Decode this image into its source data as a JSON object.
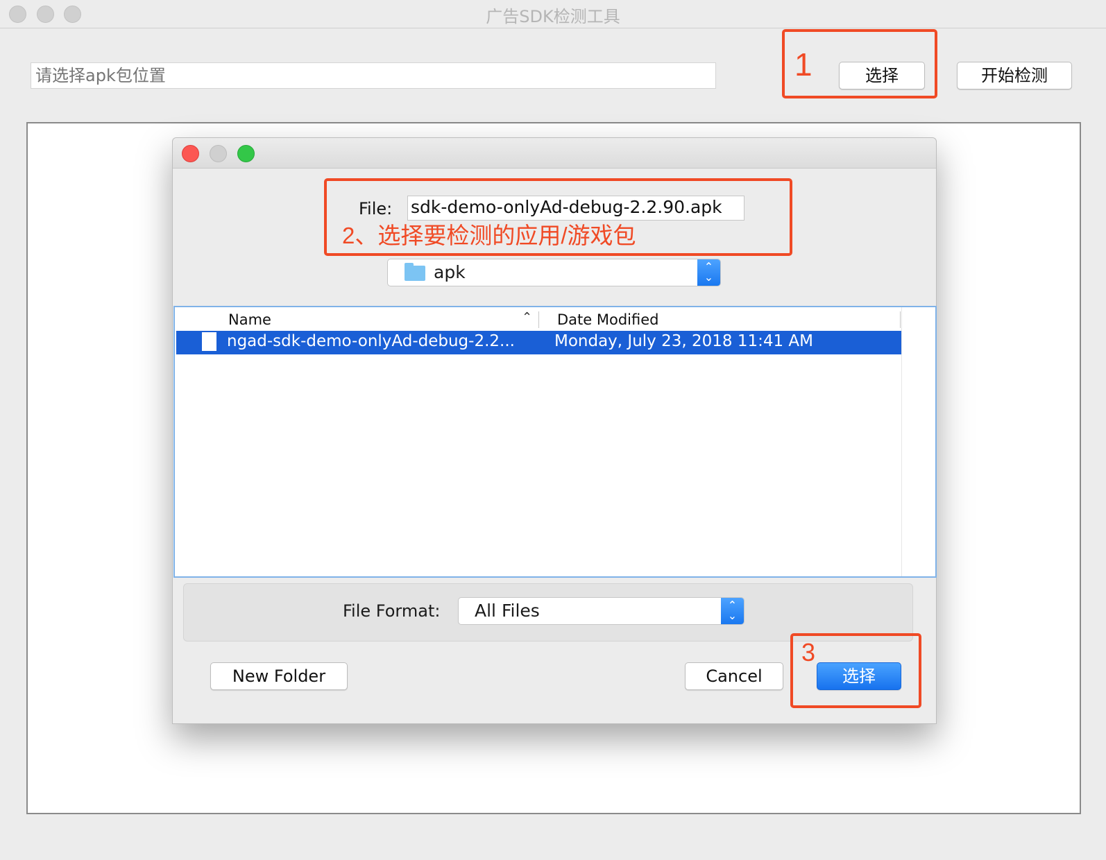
{
  "window": {
    "title": "广告SDK检测工具"
  },
  "toolbar": {
    "path_placeholder": "请选择apk包位置",
    "select_label": "选择",
    "start_label": "开始检测"
  },
  "annotations": {
    "step1": "1",
    "step2": "2、选择要检测的应用/游戏包",
    "step3": "3"
  },
  "dialog": {
    "file_label": "File:",
    "file_value": "sdk-demo-onlyAd-debug-2.2.90.apk",
    "folder": {
      "name": "apk",
      "icon": "folder-icon"
    },
    "table": {
      "columns": [
        "Name",
        "Date Modified"
      ],
      "sort_column": "Name",
      "rows": [
        {
          "name": "ngad-sdk-demo-onlyAd-debug-2.2...",
          "date": "Monday, July 23, 2018 11:41 AM",
          "selected": true,
          "icon": "document-icon"
        }
      ]
    },
    "format": {
      "label": "File Format:",
      "value": "All Files"
    },
    "buttons": {
      "new_folder": "New Folder",
      "cancel": "Cancel",
      "choose": "选择"
    }
  },
  "colors": {
    "annotation": "#f04a25",
    "selection": "#1a5fd6",
    "primary_button": "#1772ee",
    "close": "#fc5753",
    "zoom": "#33c748"
  }
}
